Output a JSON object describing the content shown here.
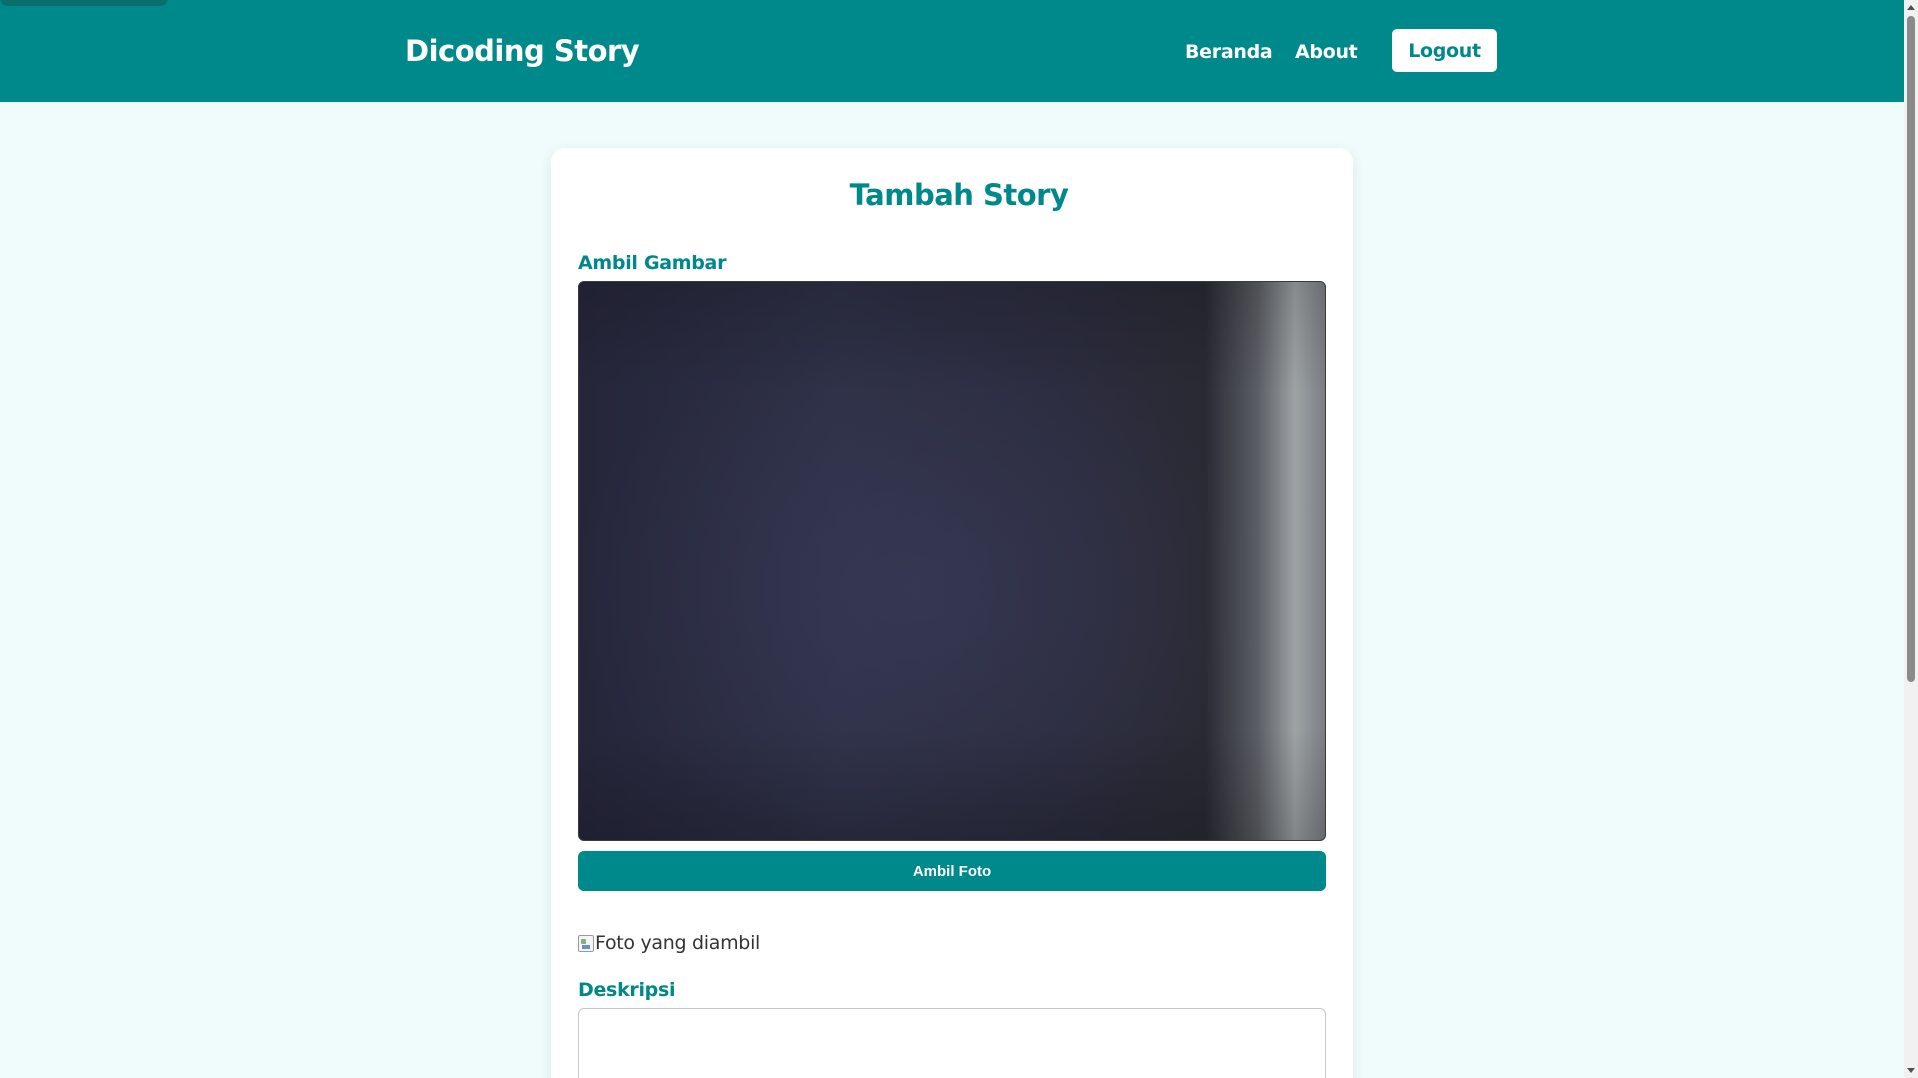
{
  "header": {
    "brand": "Dicoding Story",
    "nav": {
      "beranda": "Beranda",
      "about": "About",
      "logout": "Logout"
    }
  },
  "form": {
    "title": "Tambah Story",
    "camera_label": "Ambil Gambar",
    "capture_button": "Ambil Foto",
    "photo_alt": "Foto yang diambil",
    "description_label": "Deskripsi",
    "description_value": ""
  },
  "colors": {
    "primary": "#00898a",
    "background": "#effcfb",
    "card": "#ffffff"
  }
}
